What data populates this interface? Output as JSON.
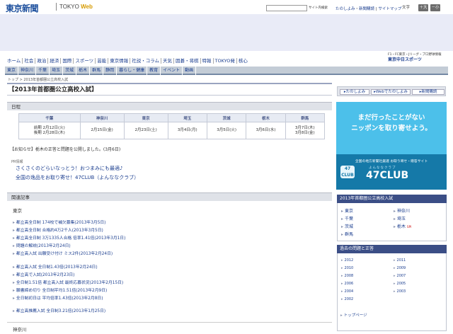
{
  "header": {
    "logo": "東京新聞",
    "sub_prefix": "TOKYO ",
    "sub_web": "Web",
    "search_button": "サイト内検索",
    "links": [
      "たのしよみ",
      "新聞購読",
      "サイトマップ"
    ],
    "font_size_label": "文字",
    "font_size_large": "＋大",
    "font_size_small": "－小"
  },
  "brand": {
    "line1": "F1・FC東京・Jリーグ・プロ野球情報",
    "line2": "東京中日スポーツ"
  },
  "global_nav": [
    "ホーム",
    "社会",
    "政治",
    "経済",
    "国際",
    "スポーツ",
    "芸能",
    "東京情報",
    "社説・コラム",
    "天気",
    "囲碁・将棋",
    "特報",
    "TOKYO発",
    "核心"
  ],
  "local_nav": [
    "東京",
    "神奈川",
    "千葉",
    "埼玉",
    "茨城",
    "栃木",
    "群馬",
    "静岡",
    "暮らし・健康",
    "教育",
    "イベント",
    "動画"
  ],
  "breadcrumb": "トップ > 2013年首都圏公立高校入試",
  "page_title": "【2013年首都圏公立高校入試】",
  "schedule": {
    "heading": "日程",
    "prefectures": [
      "千葉",
      "神奈川",
      "東京",
      "埼玉",
      "茨城",
      "栃木",
      "群馬"
    ],
    "dates": [
      [
        "前期 2月12日(火)",
        "後期 2月28日(木)"
      ],
      [
        "2月15日(金)"
      ],
      [
        "2月23日(土)"
      ],
      [
        "3月4日(月)"
      ],
      [
        "3月5日(火)"
      ],
      [
        "3月6日(水)"
      ],
      [
        "3月7日(木)",
        "3月8日(金)"
      ]
    ]
  },
  "notice": "【お知らせ】栃木の正答と問題を公開しました。(3月6日)",
  "pr": {
    "label": "PR情報",
    "items": [
      "さくさくのどらいなっとう！おつまみにも最適♪",
      "全国の逸品をお取り寄せ！47CLUB（よんななクラブ）"
    ]
  },
  "related": {
    "heading": "関連記事",
    "section_tokyo": "東京",
    "items": [
      "都立高全日制 174校で補欠募集(2013年3月5日)",
      "都立高全日制 合格約4万2千人(2013年3月5日)",
      "都立高全日制 3万1335人合格 倍率1.41倍(2013年3月1日)",
      "問題の解説(2013年2月24日)",
      "都立高入試 出願受け付け ミス2件(2013年2月24日)",
      "都立高入試 全日制1.43倍(2013年2月24日)",
      "都立高で入試(2013年2月23日)",
      "全日制1.51倍 都立高入試 最終応募状況(2013年2月15日)",
      "願書締め切り 全日制平均1.51倍(2013年2月9日)",
      "全日制初日は 平均倍率1.43倍(2013年2月8日)",
      "都立高推薦入試 全日制3.21倍(2013年1月25日)"
    ],
    "section_kanagawa": "神奈川"
  },
  "sidebar": {
    "buttons": [
      "たのしよみ",
      "Webでたのしよみ",
      "新聞購読"
    ],
    "banner": {
      "line1": "まだ行ったことがない",
      "line2": "ニッポンを取り寄せよう。",
      "small": "全国の地方新聞社厳選 お取り寄せ・贈答サイト",
      "badge": "47 CLUB",
      "kana": "よんななクラブ",
      "big": "47CLUB"
    },
    "exam_heading": "2013年首都圏公立高校入試",
    "prefs": [
      {
        "name": "東京"
      },
      {
        "name": "神奈川"
      },
      {
        "name": "千葉"
      },
      {
        "name": "埼玉"
      },
      {
        "name": "茨城"
      },
      {
        "name": "栃木",
        "tag": "SPI"
      },
      {
        "name": "群馬"
      }
    ],
    "past_heading": "過去の問題と正答",
    "years": [
      "2012",
      "2011",
      "2010",
      "2009",
      "2008",
      "2007",
      "2006",
      "2005",
      "2004",
      "2003",
      "2002"
    ],
    "top_page": "トップページ"
  }
}
